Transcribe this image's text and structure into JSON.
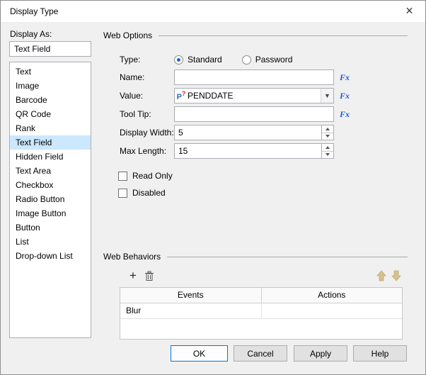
{
  "titlebar": {
    "title": "Display Type",
    "close": "×"
  },
  "display_as": {
    "label": "Display As:",
    "value": "Text Field",
    "selected_index": 5,
    "items": [
      "Text",
      "Image",
      "Barcode",
      "QR Code",
      "Rank",
      "Text Field",
      "Hidden Field",
      "Text Area",
      "Checkbox",
      "Radio Button",
      "Image Button",
      "Button",
      "List",
      "Drop-down List"
    ]
  },
  "web_options": {
    "title": "Web Options",
    "type_label": "Type:",
    "type_options": [
      {
        "label": "Standard",
        "selected": true
      },
      {
        "label": "Password",
        "selected": false
      }
    ],
    "fx_label": "Fx",
    "name": {
      "label": "Name:",
      "value": ""
    },
    "value": {
      "label": "Value:",
      "value": "PENDDATE",
      "icon": "parameter-icon"
    },
    "tooltip": {
      "label": "Tool Tip:",
      "value": ""
    },
    "display_width": {
      "label": "Display Width:",
      "value": "5"
    },
    "max_length": {
      "label": "Max Length:",
      "value": "15"
    },
    "read_only": {
      "label": "Read Only",
      "checked": false
    },
    "disabled": {
      "label": "Disabled",
      "checked": false
    }
  },
  "web_behaviors": {
    "title": "Web Behaviors",
    "icons": [
      "add-icon",
      "delete-icon",
      "move-up-icon",
      "move-down-icon"
    ],
    "table": {
      "headers": [
        "Events",
        "Actions"
      ],
      "rows": [
        [
          "Blur",
          ""
        ]
      ]
    },
    "accent_arrow_color": "#d6c28f"
  },
  "footer": {
    "buttons": [
      "OK",
      "Cancel",
      "Apply",
      "Help"
    ]
  }
}
